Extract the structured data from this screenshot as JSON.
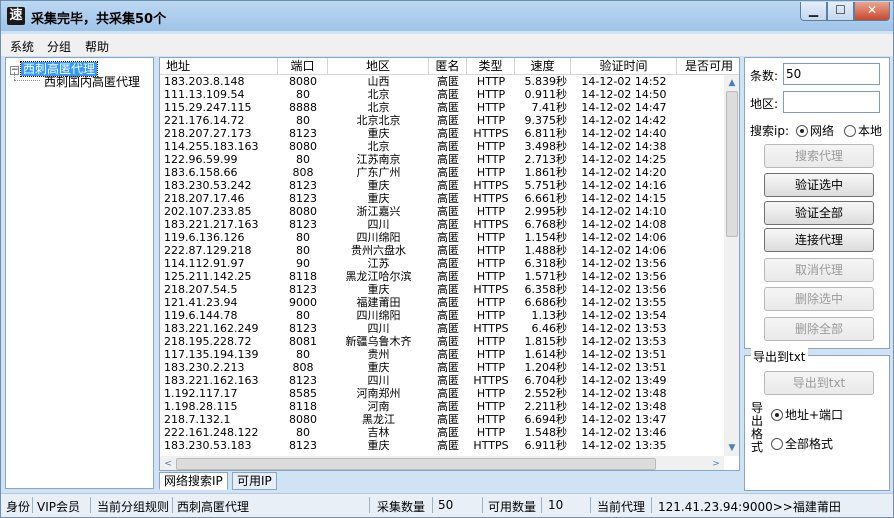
{
  "window": {
    "title": "采集完毕，共采集50个",
    "icon_char": "速",
    "min_glyph": "▁",
    "max_glyph": "☐",
    "close_glyph": "✕"
  },
  "menu": [
    "系统",
    "分组",
    "帮助"
  ],
  "tree": {
    "toggle": "−",
    "root": "西刺高匿代理",
    "child": "西刺国内高匿代理"
  },
  "table": {
    "headers": [
      "地址",
      "端口",
      "地区",
      "匿名",
      "类型",
      "速度",
      "验证时间",
      "是否可用"
    ],
    "rows": [
      [
        "183.203.8.148",
        "8080",
        "山西",
        "高匿",
        "HTTP",
        "5.839秒",
        "14-12-02 14:52"
      ],
      [
        "111.13.109.54",
        "80",
        "北京",
        "高匿",
        "HTTP",
        "0.911秒",
        "14-12-02 14:50"
      ],
      [
        "115.29.247.115",
        "8888",
        "北京",
        "高匿",
        "HTTP",
        "7.41秒",
        "14-12-02 14:47"
      ],
      [
        "221.176.14.72",
        "80",
        "北京北京",
        "高匿",
        "HTTP",
        "9.375秒",
        "14-12-02 14:42"
      ],
      [
        "218.207.27.173",
        "8123",
        "重庆",
        "高匿",
        "HTTPS",
        "6.811秒",
        "14-12-02 14:40"
      ],
      [
        "114.255.183.163",
        "8080",
        "北京",
        "高匿",
        "HTTP",
        "3.498秒",
        "14-12-02 14:38"
      ],
      [
        "122.96.59.99",
        "80",
        "江苏南京",
        "高匿",
        "HTTP",
        "2.713秒",
        "14-12-02 14:25"
      ],
      [
        "183.6.158.66",
        "808",
        "广东广州",
        "高匿",
        "HTTP",
        "1.861秒",
        "14-12-02 14:20"
      ],
      [
        "183.230.53.242",
        "8123",
        "重庆",
        "高匿",
        "HTTPS",
        "5.751秒",
        "14-12-02 14:16"
      ],
      [
        "218.207.17.46",
        "8123",
        "重庆",
        "高匿",
        "HTTPS",
        "6.661秒",
        "14-12-02 14:15"
      ],
      [
        "202.107.233.85",
        "8080",
        "浙江嘉兴",
        "高匿",
        "HTTP",
        "2.995秒",
        "14-12-02 14:10"
      ],
      [
        "183.221.217.163",
        "8123",
        "四川",
        "高匿",
        "HTTPS",
        "6.768秒",
        "14-12-02 14:08"
      ],
      [
        "119.6.136.126",
        "80",
        "四川绵阳",
        "高匿",
        "HTTP",
        "1.154秒",
        "14-12-02 14:06"
      ],
      [
        "222.87.129.218",
        "80",
        "贵州六盘水",
        "高匿",
        "HTTP",
        "1.488秒",
        "14-12-02 14:06"
      ],
      [
        "114.112.91.97",
        "90",
        "江苏",
        "高匿",
        "HTTP",
        "6.318秒",
        "14-12-02 13:56"
      ],
      [
        "125.211.142.25",
        "8118",
        "黑龙江哈尔滨",
        "高匿",
        "HTTP",
        "1.571秒",
        "14-12-02 13:56"
      ],
      [
        "218.207.54.5",
        "8123",
        "重庆",
        "高匿",
        "HTTPS",
        "6.358秒",
        "14-12-02 13:56"
      ],
      [
        "121.41.23.94",
        "9000",
        "福建莆田",
        "高匿",
        "HTTP",
        "6.686秒",
        "14-12-02 13:55"
      ],
      [
        "119.6.144.78",
        "80",
        "四川绵阳",
        "高匿",
        "HTTP",
        "1.13秒",
        "14-12-02 13:54"
      ],
      [
        "183.221.162.249",
        "8123",
        "四川",
        "高匿",
        "HTTPS",
        "6.46秒",
        "14-12-02 13:53"
      ],
      [
        "218.195.228.72",
        "8081",
        "新疆乌鲁木齐",
        "高匿",
        "HTTP",
        "1.815秒",
        "14-12-02 13:53"
      ],
      [
        "117.135.194.139",
        "80",
        "贵州",
        "高匿",
        "HTTP",
        "1.614秒",
        "14-12-02 13:51"
      ],
      [
        "183.230.2.213",
        "808",
        "重庆",
        "高匿",
        "HTTP",
        "1.204秒",
        "14-12-02 13:51"
      ],
      [
        "183.221.162.163",
        "8123",
        "四川",
        "高匿",
        "HTTPS",
        "6.704秒",
        "14-12-02 13:49"
      ],
      [
        "1.192.117.17",
        "8585",
        "河南郑州",
        "高匿",
        "HTTP",
        "2.552秒",
        "14-12-02 13:48"
      ],
      [
        "1.198.28.115",
        "8118",
        "河南",
        "高匿",
        "HTTP",
        "2.211秒",
        "14-12-02 13:48"
      ],
      [
        "218.7.132.1",
        "8080",
        "黑龙江",
        "高匿",
        "HTTP",
        "6.694秒",
        "14-12-02 13:47"
      ],
      [
        "222.161.248.122",
        "80",
        "吉林",
        "高匿",
        "HTTP",
        "1.548秒",
        "14-12-02 13:46"
      ],
      [
        "183.230.53.183",
        "8123",
        "重庆",
        "高匿",
        "HTTPS",
        "6.911秒",
        "14-12-02 13:35"
      ]
    ]
  },
  "scroll": {
    "up": "▲",
    "down": "▼",
    "left": "<",
    "right": ">"
  },
  "tabs": [
    "网络搜索IP",
    "可用IP"
  ],
  "search": {
    "count_label": "条数:",
    "count_value": "50",
    "region_label": "地区:",
    "region_value": "",
    "search_ip_label": "搜索ip:",
    "radio_network": "网络",
    "radio_local": "本地",
    "radio_network_selected": true
  },
  "buttons": {
    "search_proxy": "搜索代理",
    "verify_selected": "验证选中",
    "verify_all": "验证全部",
    "connect_proxy": "连接代理",
    "cancel_proxy": "取消代理",
    "delete_selected": "删除选中",
    "delete_all": "删除全部"
  },
  "export": {
    "group_title": "导出到txt",
    "button": "导出到txt",
    "format_label": "导出格式",
    "option_addr_port": "地址+端口",
    "option_full": "全部格式",
    "addr_port_selected": true
  },
  "status": {
    "identity_label": "身份",
    "identity_value": "VIP会员",
    "rule_label": "当前分组规则",
    "rule_value": "西刺高匿代理",
    "collected_label": "采集数量",
    "collected_value": "50",
    "available_label": "可用数量",
    "available_value": "10",
    "current_proxy_label": "当前代理",
    "current_proxy_value": "121.41.23.94:9000>>福建莆田"
  },
  "colors": {
    "title_bg": "#9fc4e8",
    "selection": "#3399ff",
    "close_button": "#c9472c"
  }
}
